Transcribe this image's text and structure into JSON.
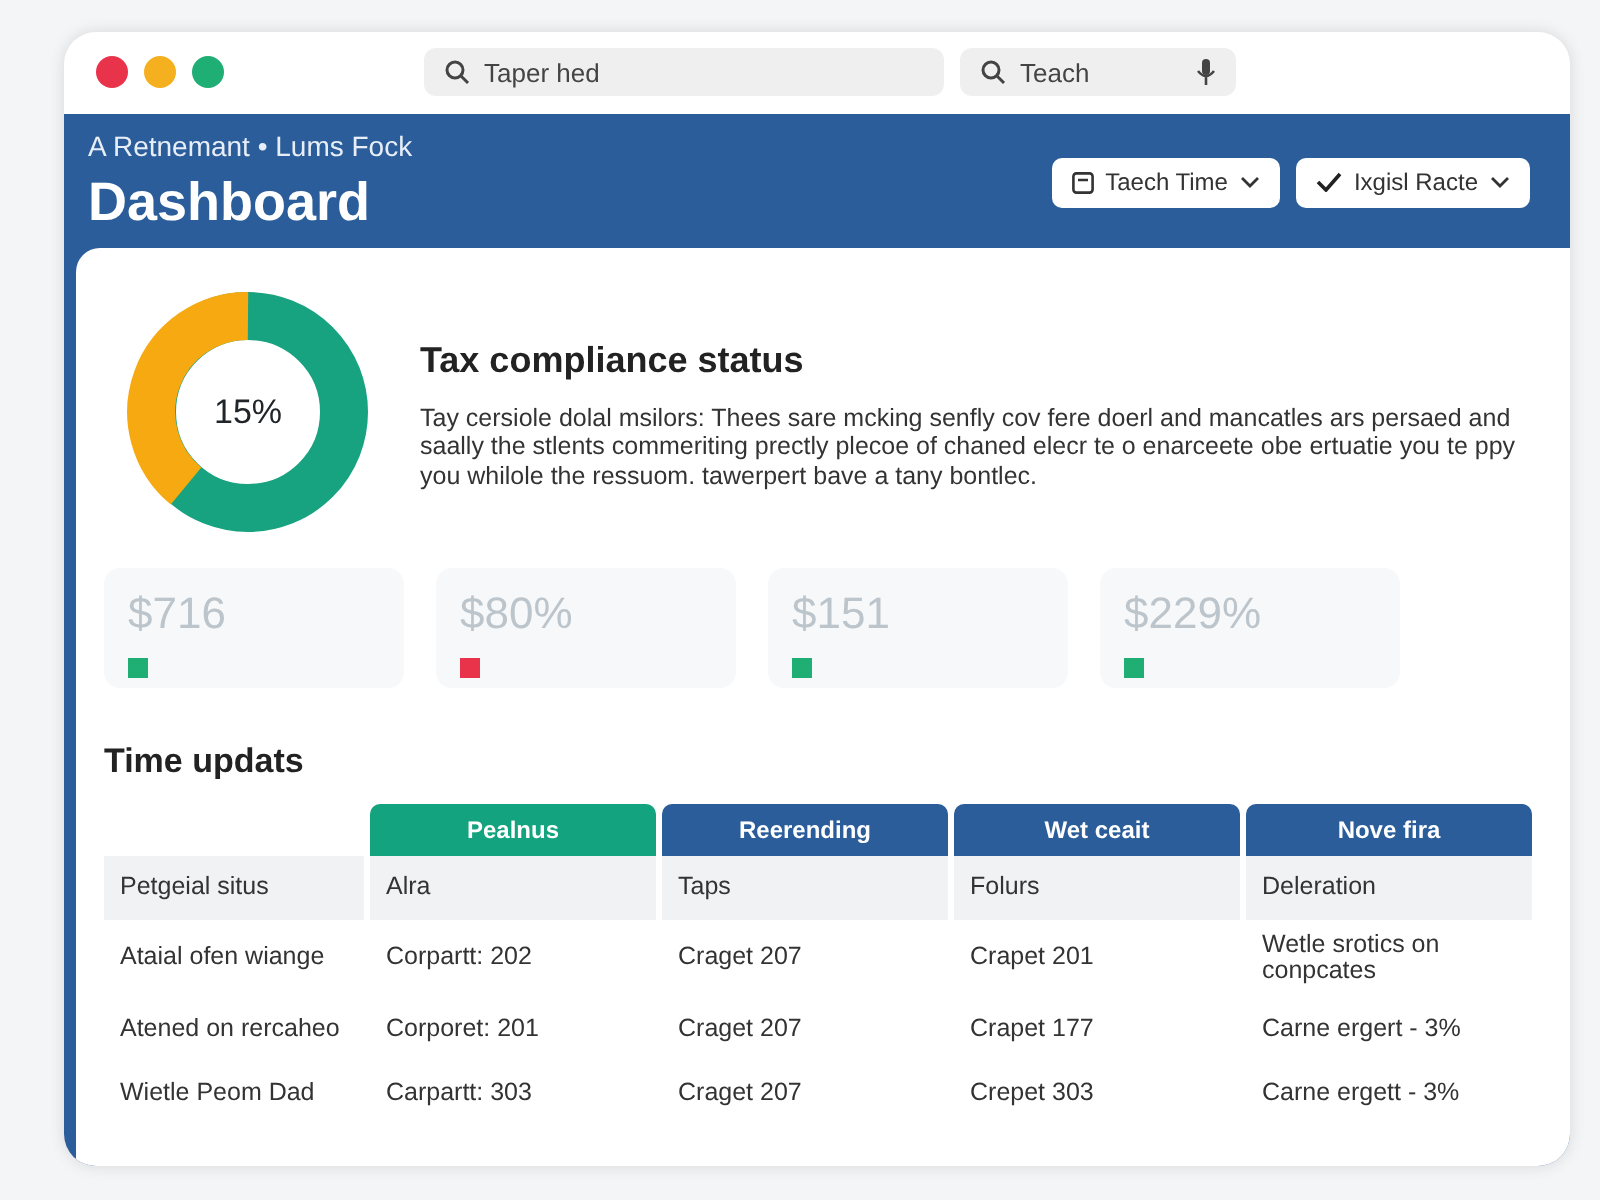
{
  "window": {
    "controls": [
      {
        "color": "#e8334a"
      },
      {
        "color": "#f5b020"
      },
      {
        "color": "#1fae74"
      }
    ]
  },
  "search_fields": [
    {
      "placeholder": "Taper hed",
      "kind": "plain"
    },
    {
      "placeholder": "Teach",
      "kind": "mic"
    }
  ],
  "header": {
    "subtitle": "A Retnemant • Lums Fock",
    "title": "Dashboard",
    "buttons": [
      {
        "label": "Taech Time",
        "kind": "calendar"
      },
      {
        "label": "Ixgisl Racte",
        "kind": "check"
      }
    ]
  },
  "status": {
    "percent": "15%",
    "title": "Tax compliance status",
    "text": "Tay cersiole dolal msilors: Thees sare mcking senfly cov fere doerl and mancatles ars persaed and saally the stlents commeriting prectly plecoe of chaned elecr te o enarceete obe ertuatie you te ppy you whilole the ressuom. tawerpert bave a tany bontlec."
  },
  "stats": [
    {
      "value": "$716",
      "color": "#1fae74"
    },
    {
      "value": "$80%",
      "color": "#e8334a"
    },
    {
      "value": "$151",
      "color": "#1fae74"
    },
    {
      "value": "$229%",
      "color": "#1fae74"
    }
  ],
  "table": {
    "title": "Time updats",
    "columns": [
      {},
      {
        "label": "Pealnus",
        "color": "#14a37f"
      },
      {
        "label": "Reerending",
        "color": "#2a5d9a"
      },
      {
        "label": "Wet ceait",
        "color": "#2a5d9a"
      },
      {
        "label": "Nove fira",
        "color": "#2a5d9a"
      }
    ],
    "rows": [
      {
        "cells": [
          "Petgeial situs",
          "Alra",
          "Taps",
          "Folurs",
          "Deleration"
        ],
        "shaded": true
      },
      {
        "cells": [
          "Ataial ofen wiange",
          "Corpartt: 202",
          "Craget 207",
          "Crapet 201",
          "Wetle srotics on conpcates"
        ],
        "shaded": false
      },
      {
        "cells": [
          "Atened on rercaheo",
          "Corporet: 201",
          "Craget 207",
          "Crapet 177",
          "Carne ergert - 3%"
        ],
        "shaded": false
      },
      {
        "cells": [
          "Wietle Peom Dad",
          "Carpartt: 303",
          "Craget 207",
          "Crepet 303",
          "Carne ergett - 3%"
        ],
        "shaded": false
      }
    ]
  }
}
